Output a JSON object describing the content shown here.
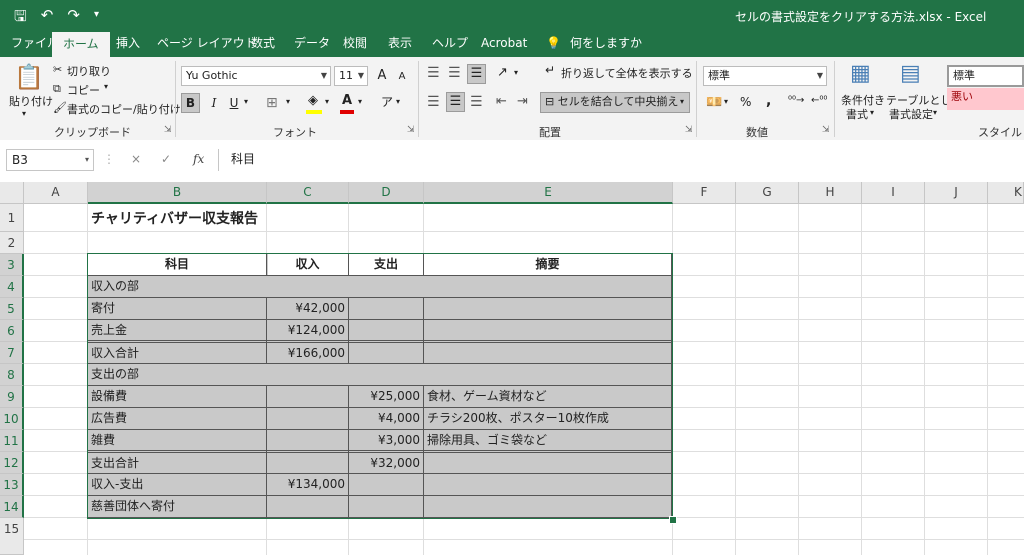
{
  "window": {
    "title": "セルの書式設定をクリアする方法.xlsx  -  Excel"
  },
  "qat": {
    "save_icon": "save-icon",
    "undo_icon": "undo-icon",
    "redo_icon": "redo-icon"
  },
  "tabs": [
    "ファイル",
    "ホーム",
    "挿入",
    "ページ レイアウト",
    "数式",
    "データ",
    "校閲",
    "表示",
    "ヘルプ",
    "Acrobat",
    "何をしますか"
  ],
  "ribbon": {
    "clipboard": {
      "paste": "貼り付け",
      "cut": "切り取り",
      "copy": "コピー",
      "format_painter": "書式のコピー/貼り付け",
      "label": "クリップボード"
    },
    "font": {
      "name": "Yu Gothic",
      "size": "11",
      "bold": "B",
      "italic": "I",
      "underline": "U",
      "grow": "A",
      "shrink": "A",
      "label": "フォント"
    },
    "alignment": {
      "wrap": "折り返して全体を表示する",
      "merge": "セルを結合して中央揃え",
      "label": "配置"
    },
    "number": {
      "format": "標準",
      "percent": "%",
      "comma": ",",
      "label": "数値"
    },
    "styles": {
      "conditional_1": "条件付き",
      "conditional_2": "書式",
      "table_1": "テーブルとして",
      "table_2": "書式設定",
      "normal": "標準",
      "bad": "悪い",
      "label": "スタイル"
    }
  },
  "formula_bar": {
    "name_box": "B3",
    "cancel": "×",
    "enter": "✓",
    "fx": "fx",
    "content": "科目"
  },
  "columns": [
    "A",
    "B",
    "C",
    "D",
    "E",
    "F",
    "G",
    "H",
    "I",
    "J",
    "K"
  ],
  "rows": [
    "1",
    "2",
    "3",
    "4",
    "5",
    "6",
    "7",
    "8",
    "9",
    "10",
    "11",
    "12",
    "13",
    "14",
    "15"
  ],
  "sheet": {
    "title": "チャリティバザー収支報告",
    "headers": {
      "b": "科目",
      "c": "収入",
      "d": "支出",
      "e": "摘要"
    },
    "cells": {
      "r4b": "収入の部",
      "r5b": "寄付",
      "r5c": "¥42,000",
      "r6b": "売上金",
      "r6c": "¥124,000",
      "r7b": "収入合計",
      "r7c": "¥166,000",
      "r8b": "支出の部",
      "r9b": "設備費",
      "r9d": "¥25,000",
      "r9e": "食材、ゲーム資材など",
      "r10b": "広告費",
      "r10d": "¥4,000",
      "r10e": "チラシ200枚、ポスター10枚作成",
      "r11b": "雑費",
      "r11d": "¥3,000",
      "r11e": "掃除用具、ゴミ袋など",
      "r12b": "支出合計",
      "r12d": "¥32,000",
      "r13b": "収入-支出",
      "r13c": "¥134,000",
      "r14b": "慈善団体へ寄付"
    }
  }
}
